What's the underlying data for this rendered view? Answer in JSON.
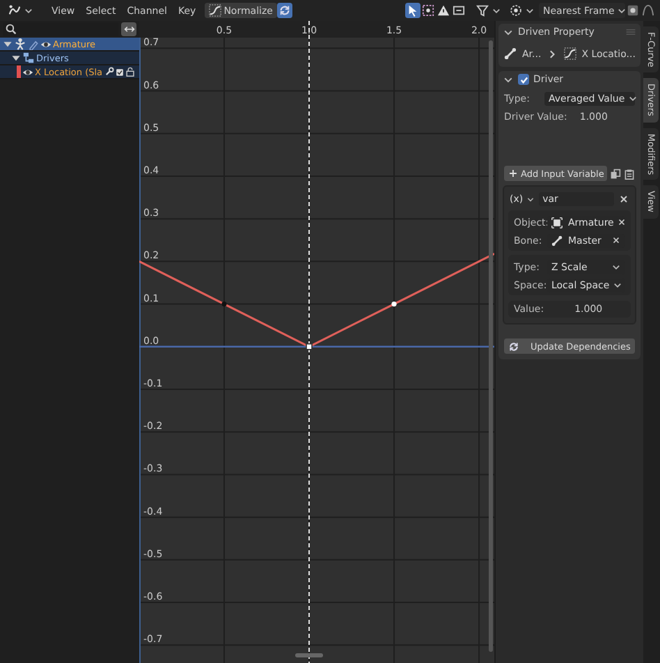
{
  "header": {
    "menus": [
      "View",
      "Select",
      "Channel",
      "Key"
    ],
    "normalize": {
      "label": "Normalize",
      "on": false
    },
    "snapping": "Nearest Frame"
  },
  "channels": [
    {
      "label": "Armature",
      "kind": "object",
      "selected": true,
      "expanded": true,
      "children": [
        {
          "label": "Drivers",
          "kind": "group",
          "selected": false,
          "expanded": true,
          "children": [
            {
              "label": "X Location (Sla",
              "kind": "fcurve",
              "selected": false
            }
          ]
        }
      ]
    }
  ],
  "graph": {
    "chart_data": {
      "type": "line",
      "x": [
        0,
        0.5,
        1,
        1.5,
        2.09
      ],
      "series": [
        {
          "color": "#e0605a",
          "values": [
            0.2,
            0.1,
            0,
            0.1,
            0.218
          ]
        }
      ],
      "xlim": [
        0,
        2.09
      ],
      "ylim": [
        -0.742,
        0.725
      ],
      "xticks": [
        0.5,
        {
          "value": 1,
          "label": "1.0"
        },
        1.5,
        {
          "value": 2,
          "label": "2.0"
        }
      ],
      "yticks": [
        {
          "value": 0.7,
          "label": "0.7"
        },
        {
          "value": 0.6,
          "label": "0.6"
        },
        {
          "value": 0.5,
          "label": "0.5"
        },
        {
          "value": 0.4,
          "label": "0.4"
        },
        {
          "value": 0.3,
          "label": "0.3"
        },
        {
          "value": 0.2,
          "label": "0.2"
        },
        {
          "value": 0.1,
          "label": "0.1"
        },
        {
          "value": 0,
          "label": "0.0"
        },
        {
          "value": -0.1,
          "label": "-0.1"
        },
        {
          "value": -0.2,
          "label": "-0.2"
        },
        {
          "value": -0.3,
          "label": "-0.3"
        },
        {
          "value": -0.4,
          "label": "-0.4"
        },
        {
          "value": -0.5,
          "label": "-0.5"
        },
        {
          "value": -0.6,
          "label": "-0.6"
        },
        {
          "value": -0.7,
          "label": "-0.7"
        }
      ],
      "grid": true,
      "ref_lines": [
        {
          "axis": "x",
          "value": 1
        },
        {
          "axis": "y",
          "value": 0
        }
      ]
    }
  },
  "sidebar": {
    "driven_property": {
      "title": "Driven Property",
      "expanded": true,
      "object": "Ar...",
      "property": "X Locatio..."
    },
    "driver": {
      "title": "Driver",
      "expanded": true,
      "enabled": true,
      "type_label": "Type:",
      "type": "Averaged Value",
      "value_label": "Driver Value:",
      "value": "1.000",
      "add_variable": "Add Input Variable",
      "variable": {
        "type": "(x)",
        "name": "var",
        "targets": [
          {
            "label": "Object:",
            "value": "Armature",
            "kind": "object"
          },
          {
            "label": "Bone:",
            "value": "Master",
            "kind": "bone"
          }
        ],
        "type_label": "Type:",
        "transform": "Z Scale",
        "space_label": "Space:",
        "space": "Local Space",
        "value_label": "Value:",
        "value": "1.000"
      },
      "update_button": "Update Dependencies"
    }
  },
  "tabs": [
    {
      "label": "F-Curve",
      "selected": false
    },
    {
      "label": "Drivers",
      "selected": true
    },
    {
      "label": "Modifiers",
      "selected": false
    },
    {
      "label": "View",
      "selected": false
    }
  ]
}
